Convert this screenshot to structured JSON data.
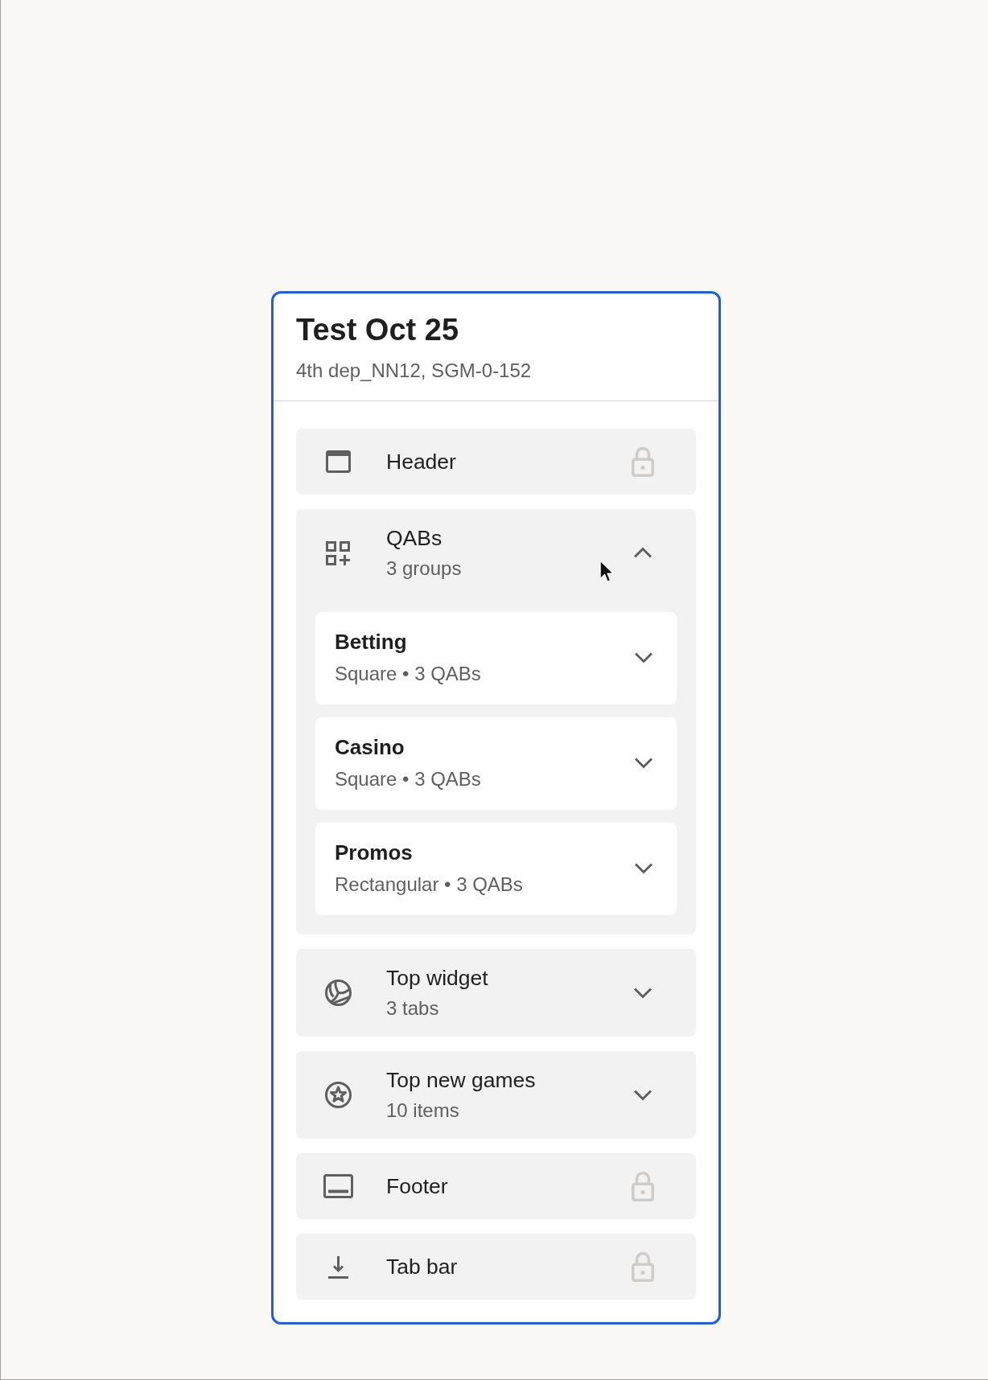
{
  "panel": {
    "title": "Test Oct 25",
    "subtitle": "4th dep_NN12, SGM-0-152"
  },
  "sections": [
    {
      "kind": "locked",
      "label": "Header"
    },
    {
      "kind": "expandable",
      "label": "QABs",
      "detail": "3 groups",
      "expanded": true,
      "groups": [
        {
          "label": "Betting",
          "detail": "Square • 3 QABs",
          "expanded": false
        },
        {
          "label": "Casino",
          "detail": "Square • 3 QABs",
          "expanded": false
        },
        {
          "label": "Promos",
          "detail": "Rectangular • 3 QABs",
          "expanded": false
        }
      ]
    },
    {
      "kind": "expandable",
      "label": "Top widget",
      "detail": "3 tabs",
      "expanded": false
    },
    {
      "kind": "expandable",
      "label": "Top new games",
      "detail": "10 items",
      "expanded": false
    },
    {
      "kind": "locked",
      "label": "Footer"
    },
    {
      "kind": "locked",
      "label": "Tab bar"
    }
  ]
}
